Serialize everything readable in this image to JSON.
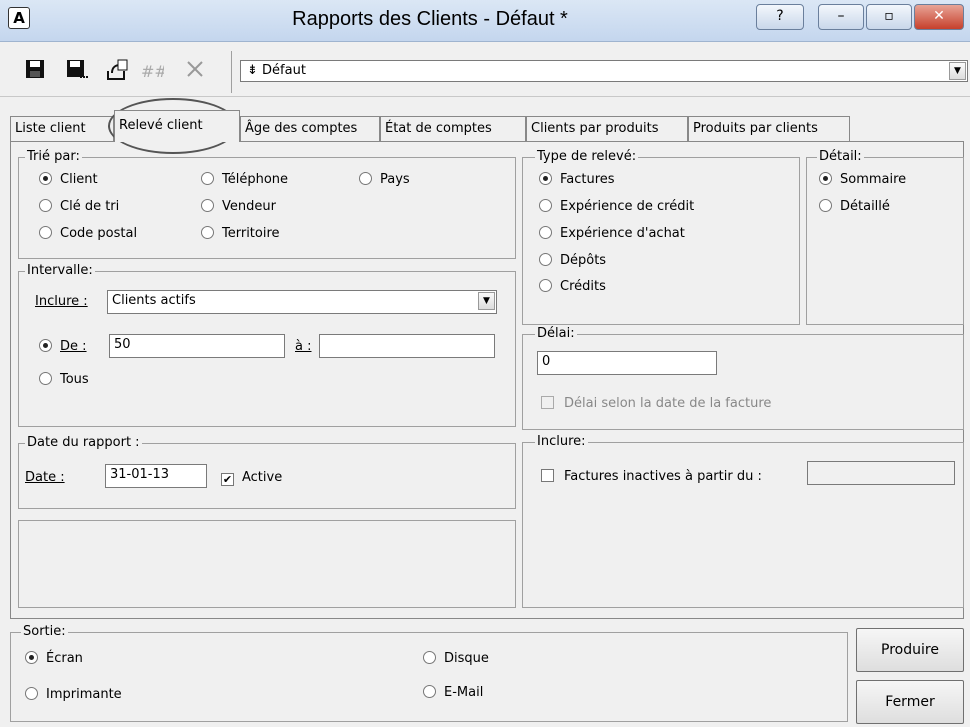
{
  "window": {
    "app_icon": "A",
    "title": "Rapports des Clients - Défaut *",
    "help_label": "?",
    "minimize_label": "–",
    "maximize_label": "▫",
    "close_label": "✕"
  },
  "toolbar": {
    "icons": [
      "save-icon",
      "save-as-icon",
      "export-icon",
      "numbering-icon",
      "delete-icon"
    ],
    "profile_value": "Défaut",
    "profile_prefix": "⇟"
  },
  "tabs": [
    {
      "label": "Liste client"
    },
    {
      "label": "Relevé client",
      "active": true
    },
    {
      "label": "Âge des comptes"
    },
    {
      "label": "État de comptes"
    },
    {
      "label": "Clients par produits"
    },
    {
      "label": "Produits par clients"
    }
  ],
  "sort": {
    "label": "Trié par:",
    "options": [
      "Client",
      "Téléphone",
      "Pays",
      "Clé de tri",
      "Vendeur",
      "Code postal",
      "Territoire"
    ],
    "selected": "Client"
  },
  "interval": {
    "label": "Intervalle:",
    "include_label": "Inclure :",
    "include_value": "Clients actifs",
    "from_label": "De :",
    "from_value": "50",
    "to_label": "à :",
    "to_value": "",
    "all_label": "Tous"
  },
  "report_date": {
    "label": "Date du rapport :",
    "date_label": "Date :",
    "date_value": "31-01-13",
    "active_label": "Active",
    "active_checked": true
  },
  "statement_type": {
    "label": "Type de relevé:",
    "options": [
      "Factures",
      "Expérience de crédit",
      "Expérience d'achat",
      "Dépôts",
      "Crédits"
    ],
    "selected": "Factures"
  },
  "detail": {
    "label": "Détail:",
    "options": [
      "Sommaire",
      "Détaillé"
    ],
    "selected": "Sommaire"
  },
  "delay": {
    "label": "Délai:",
    "value": "0",
    "by_invoice_date_label": "Délai selon la date de la facture"
  },
  "include": {
    "label": "Inclure:",
    "inactive_invoices_label": "Factures inactives à partir du :",
    "inactive_value": ""
  },
  "output": {
    "label": "Sortie:",
    "options": [
      "Écran",
      "Disque",
      "Imprimante",
      "E-Mail"
    ],
    "selected": "Écran"
  },
  "buttons": {
    "produce": "Produire",
    "close": "Fermer"
  }
}
